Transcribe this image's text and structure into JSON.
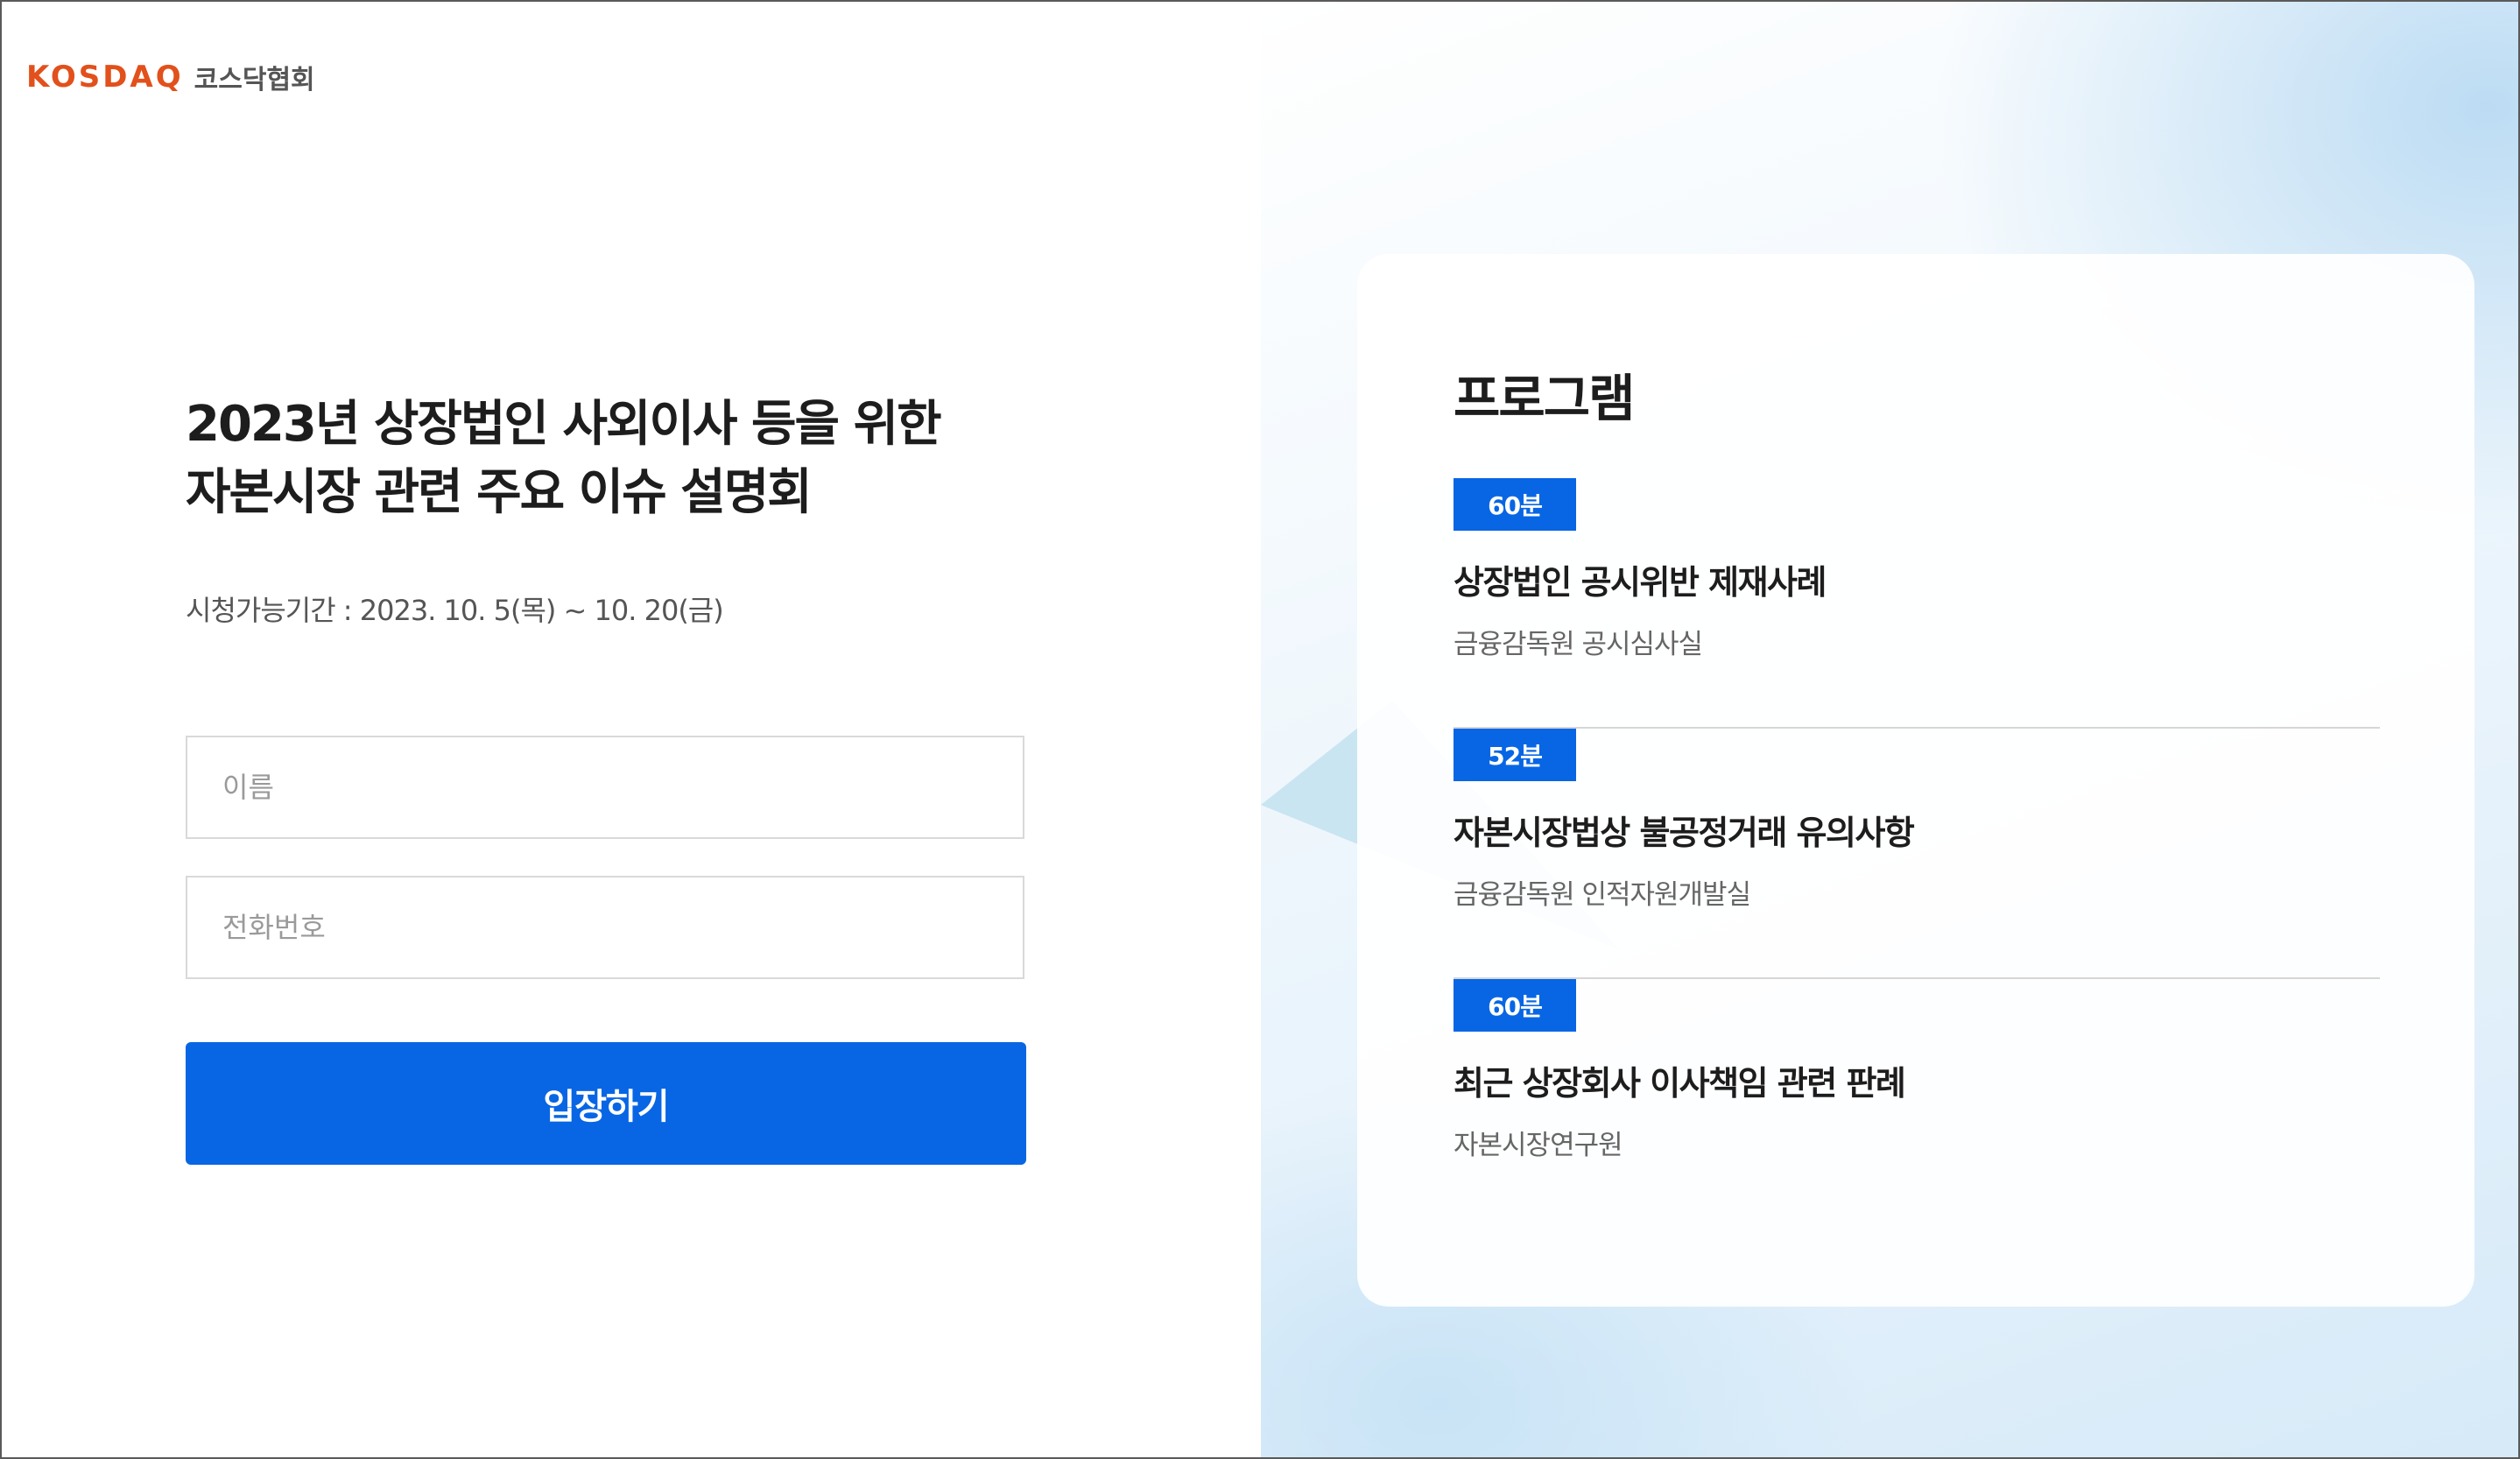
{
  "brand": {
    "logo_en": "KOSDAQ",
    "logo_kr": "코스닥협회",
    "accent_color": "#e2501b"
  },
  "main": {
    "title_line1": "2023년 상장법인 사외이사 등을 위한",
    "title_line2": "자본시장 관련 주요 이슈 설명회",
    "period": "시청가능기간 : 2023. 10. 5(목) ~ 10. 20(금)"
  },
  "form": {
    "name_placeholder": "이름",
    "name_value": "",
    "phone_placeholder": "전화번호",
    "phone_value": "",
    "submit_label": "입장하기",
    "button_color": "#0866e4"
  },
  "program": {
    "title": "프로그램",
    "items": [
      {
        "duration": "60분",
        "title": "상장법인 공시위반 제재사례",
        "presenter": "금융감독원 공시심사실"
      },
      {
        "duration": "52분",
        "title": "자본시장법상 불공정거래 유의사항",
        "presenter": "금융감독원 인적자원개발실"
      },
      {
        "duration": "60분",
        "title": "최근 상장회사 이사책임 관련 판례",
        "presenter": "자본시장연구원"
      }
    ]
  }
}
